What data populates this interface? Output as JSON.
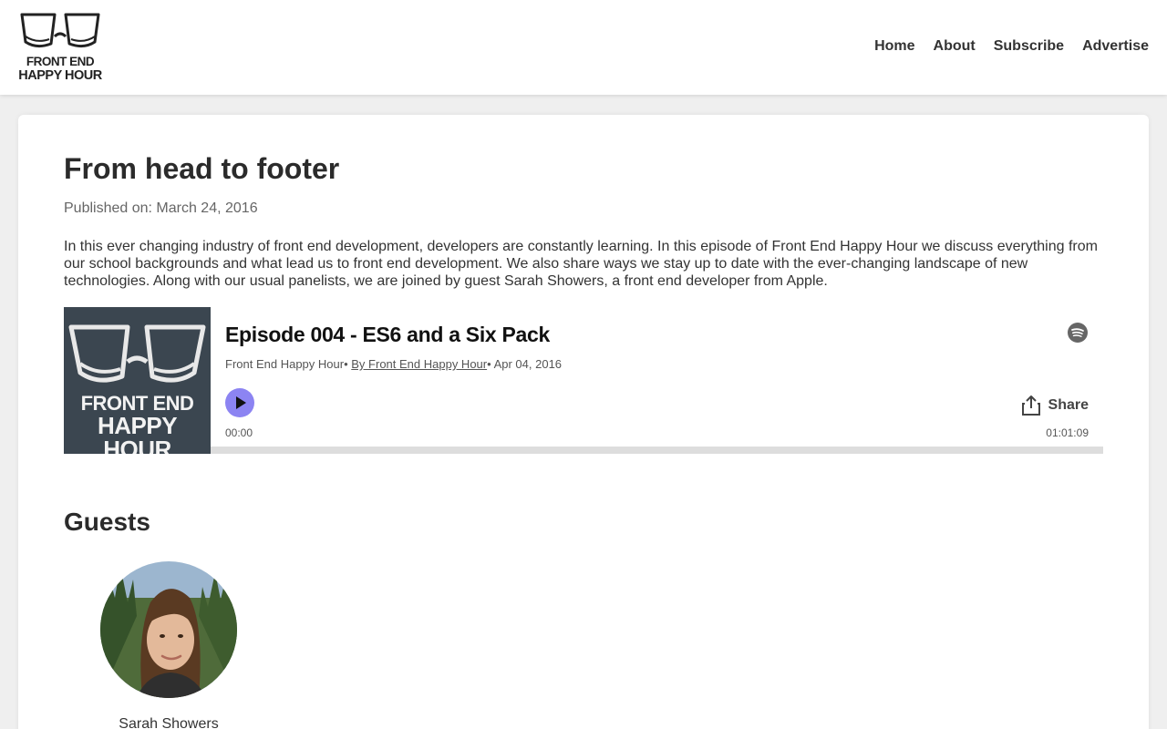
{
  "header": {
    "logo": {
      "line1": "FRONT END",
      "line2": "HAPPY HOUR"
    },
    "nav": [
      {
        "label": "Home"
      },
      {
        "label": "About"
      },
      {
        "label": "Subscribe"
      },
      {
        "label": "Advertise"
      }
    ]
  },
  "episode": {
    "title": "From head to footer",
    "published": "Published on: March 24, 2016",
    "description": "In this ever changing industry of front end development, developers are constantly learning. In this episode of Front End Happy Hour we discuss everything from our school backgrounds and what lead us to front end development. We also share ways we stay up to date with the ever-changing landscape of new technologies. Along with our usual panelists, we are joined by guest Sarah Showers, a front end developer from Apple."
  },
  "player": {
    "artwork": {
      "line1": "FRONT END",
      "line2": "HAPPY HOUR"
    },
    "episode_title": "Episode 004 - ES6 and a Six Pack",
    "show_name": "Front End Happy Hour",
    "author_link": "By Front End Happy Hour",
    "date": "Apr 04, 2016",
    "separator": "•",
    "share_label": "Share",
    "time_current": "00:00",
    "time_total": "01:01:09",
    "progress_percent": 0,
    "icons": {
      "spotify": "spotify-icon",
      "play": "play-icon",
      "share": "share-icon"
    }
  },
  "guests": {
    "heading": "Guests",
    "items": [
      {
        "name": "Sarah Showers"
      }
    ]
  },
  "colors": {
    "accent": "#8c84f2",
    "artwork_bg": "#3b4650",
    "page_bg": "#efefef"
  }
}
